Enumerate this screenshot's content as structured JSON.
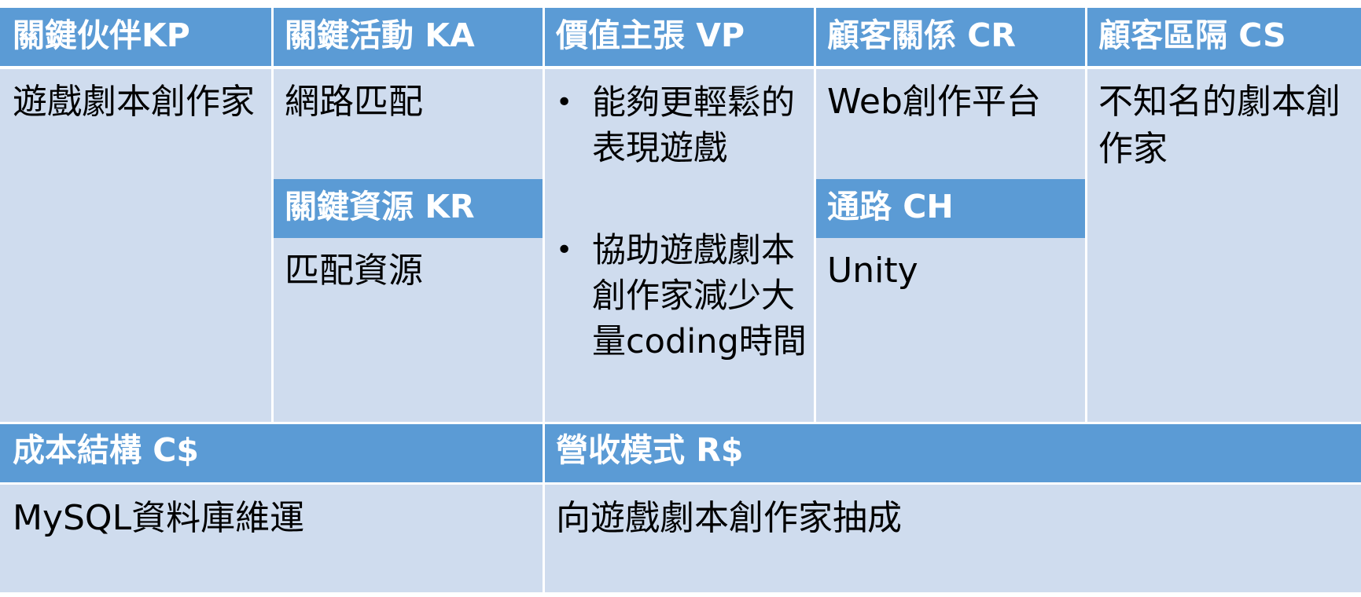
{
  "canvas": {
    "kp": {
      "header": "關鍵伙伴KP",
      "body": "遊戲劇本創作家"
    },
    "ka": {
      "header": "關鍵活動 KA",
      "body": "網路匹配"
    },
    "kr": {
      "header": "關鍵資源 KR",
      "body": "匹配資源"
    },
    "vp": {
      "header": "價值主張 VP",
      "items": [
        "能夠更輕鬆的表現遊戲",
        "協助遊戲劇本創作家減少大量coding時間"
      ]
    },
    "cr": {
      "header": "顧客關係 CR",
      "body": "Web創作平台"
    },
    "ch": {
      "header": "通路 CH",
      "body": "Unity"
    },
    "cs": {
      "header": "顧客區隔 CS",
      "body": "不知名的劇本創作家"
    },
    "cost": {
      "header": "成本結構 C$",
      "body": "MySQL資料庫維運"
    },
    "revenue": {
      "header": "營收模式 R$",
      "body": "向遊戲劇本創作家抽成"
    }
  },
  "colors": {
    "header": "#5b9bd5",
    "cell": "#cfdcee",
    "header_text": "#ffffff",
    "body_text": "#000000"
  }
}
